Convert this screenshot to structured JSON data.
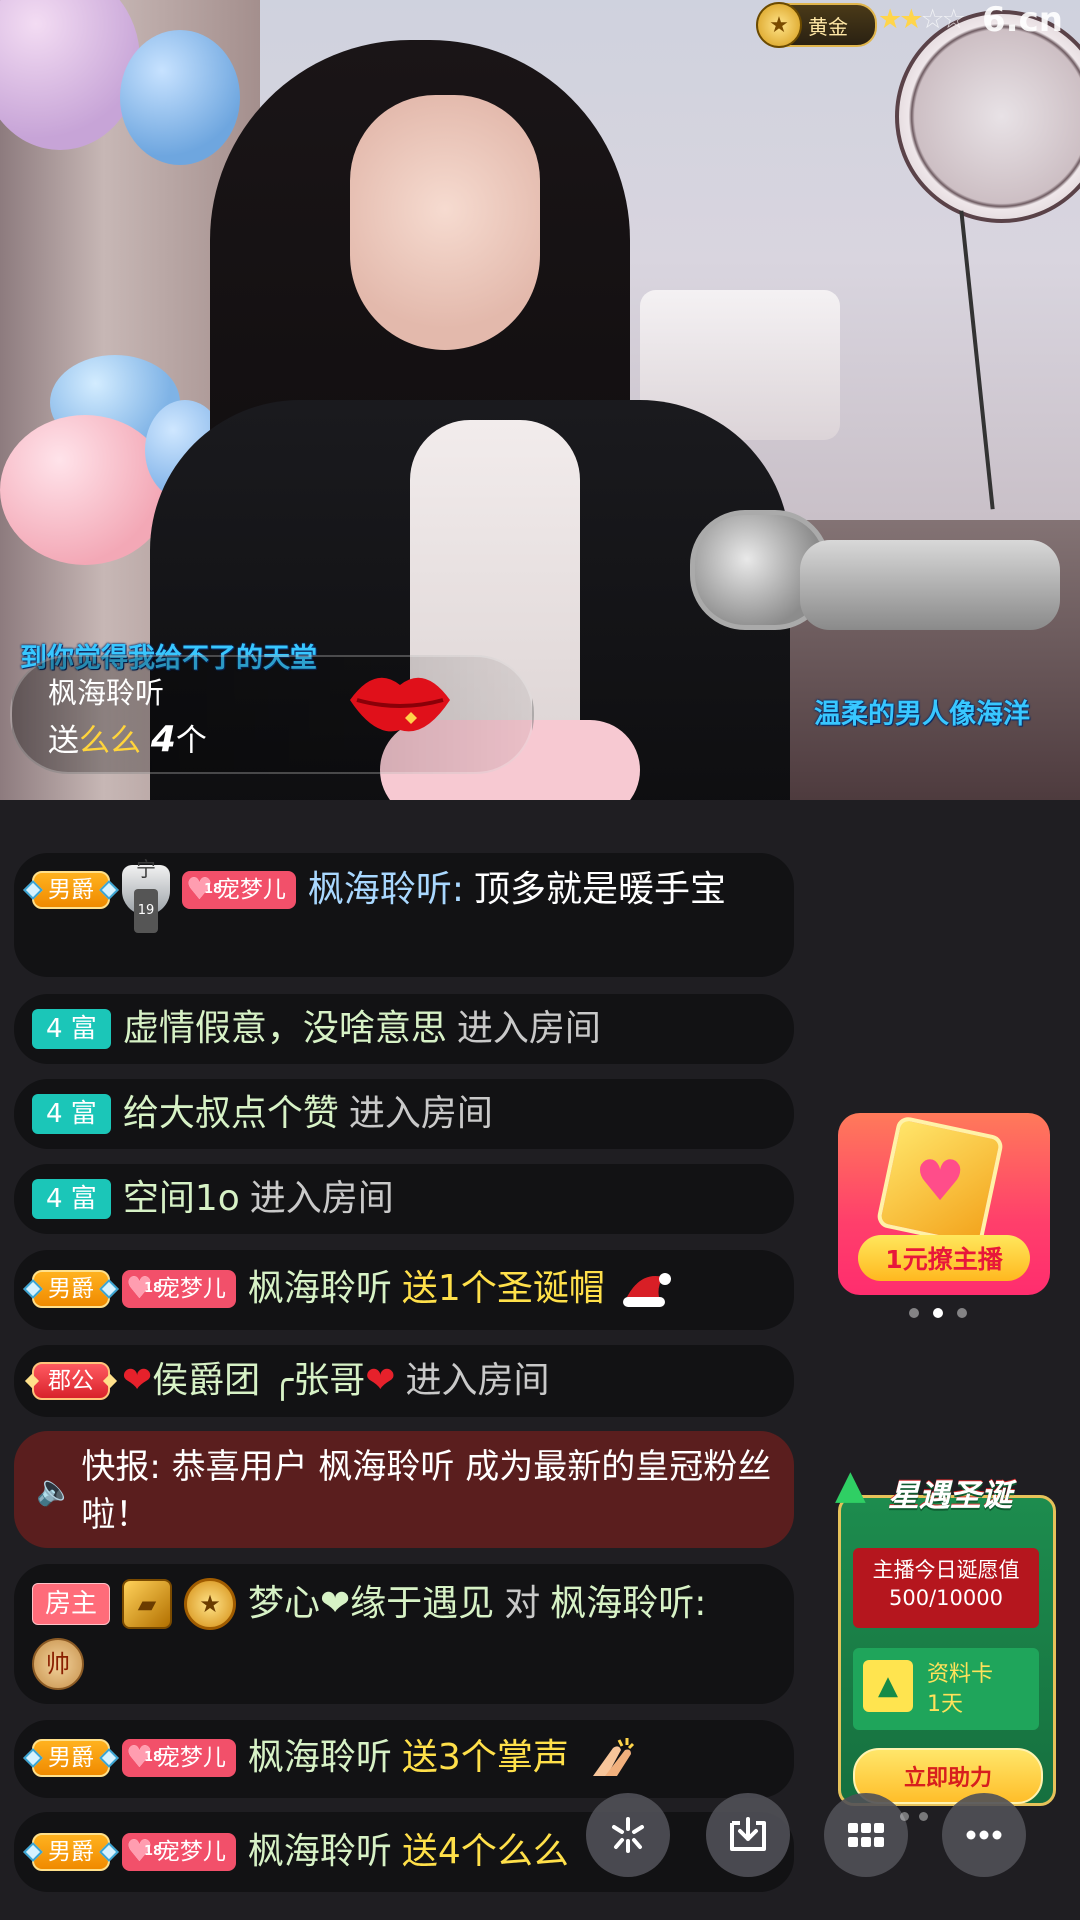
{
  "stream": {
    "level_badge": "黄金",
    "level_stars": [
      "★",
      "★",
      "☆",
      "☆"
    ],
    "watermark": "6.cn",
    "stage_text_left": "到你觉得我给不了的天堂",
    "stage_text_right": "温柔的男人像海洋"
  },
  "gift_banner": {
    "user": "枫海聆听",
    "prefix": "送",
    "gift_name": "么么",
    "count": "4",
    "unit": "个"
  },
  "chat": [
    {
      "badges": [
        "男爵",
        "宁",
        "宠梦儿"
      ],
      "guard_level": "19",
      "fan_level": "18",
      "user": "枫海聆听:",
      "text": "顶多就是暖手宝"
    },
    {
      "rich": "4 富",
      "user": "虚情假意，没啥意思",
      "action": "进入房间"
    },
    {
      "rich": "4 富",
      "user": "给大叔点个赞",
      "action": "进入房间"
    },
    {
      "rich": "4 富",
      "user": "空间1o",
      "action": "进入房间"
    },
    {
      "noble": "男爵",
      "fan": "宠梦儿",
      "fan_level": "18",
      "user": "枫海聆听",
      "gift": "送1个圣诞帽"
    },
    {
      "noble": "郡公",
      "user_parts": [
        "❤",
        "侯爵团 ╭张哥",
        "❤"
      ],
      "action": "进入房间"
    },
    {
      "alert_icon": "speaker-icon",
      "text": "快报: 恭喜用户 枫海聆听 成为最新的皇冠粉丝啦！"
    },
    {
      "host": "房主",
      "user": "梦心❤缘于遇见",
      "to": "对",
      "target": "枫海聆听:",
      "chess": "帅"
    },
    {
      "noble": "男爵",
      "fan": "宠梦儿",
      "fan_level": "18",
      "user": "枫海聆听",
      "gift": "送3个掌声"
    },
    {
      "noble": "男爵",
      "fan": "宠梦儿",
      "fan_level": "18",
      "user": "枫海聆听",
      "gift": "送4个么么"
    }
  ],
  "promo": {
    "button": "1元撩主播"
  },
  "xmas": {
    "title": "星遇圣诞",
    "wish_label": "主播今日诞愿值",
    "wish_value": "500/10000",
    "reward_name": "资料卡",
    "reward_duration": "1天",
    "help_button": "立即助力"
  },
  "toolbar": [
    "sparkle-icon",
    "download-icon",
    "grid-icon",
    "more-icon"
  ]
}
